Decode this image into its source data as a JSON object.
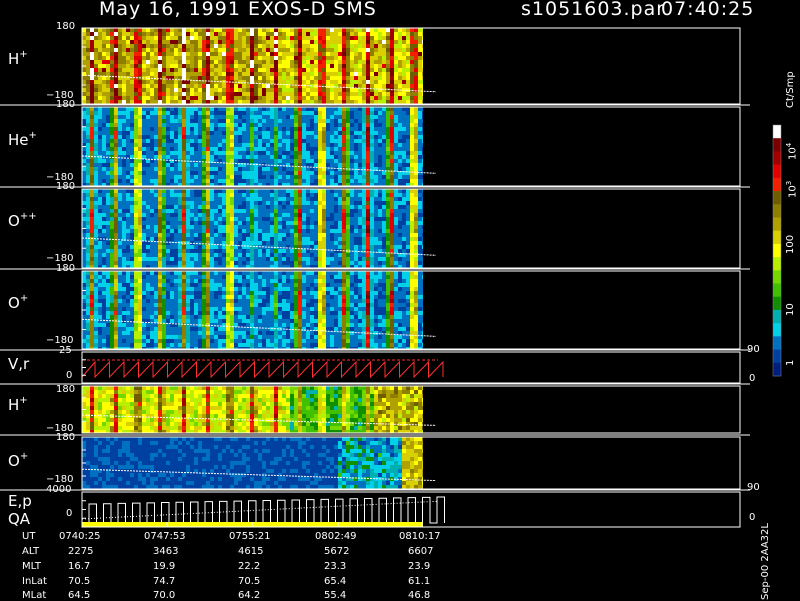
{
  "header": {
    "title": "May 16, 1991    EXOS-D SMS",
    "file": "s1051603.par",
    "time": "07:40:25"
  },
  "colorbar": {
    "label": "Ct/Smp",
    "ticks": [
      "10",
      "10",
      "10",
      "100",
      "10",
      "1"
    ],
    "exponents": [
      "4",
      "3",
      "",
      "",
      "",
      ""
    ],
    "colors": [
      "#ffffff",
      "#7a0000",
      "#a00000",
      "#e00000",
      "#f02000",
      "#6e5e00",
      "#8f7f00",
      "#b0a000",
      "#d8d000",
      "#ffff00",
      "#b8f000",
      "#74d800",
      "#40c000",
      "#109000",
      "#00b0b0",
      "#00d0e8",
      "#0070c0",
      "#0040a0",
      "#001e7c"
    ]
  },
  "panels": [
    {
      "id": "h-plus",
      "label": "H",
      "sup": "+",
      "ymax": "180",
      "ymin": "−180"
    },
    {
      "id": "he-plus",
      "label": "He",
      "sup": "+",
      "ymax": "180",
      "ymin": "−180"
    },
    {
      "id": "o-plusplus",
      "label": "O",
      "sup": "++",
      "ymax": "180",
      "ymin": "−180"
    },
    {
      "id": "o-plus",
      "label": "O",
      "sup": "+",
      "ymax": "180",
      "ymin": "−180"
    },
    {
      "id": "vr",
      "label": "V,r",
      "sup": "",
      "ymax": "25",
      "ymin": "0",
      "rmax": "90",
      "rmin": "0"
    },
    {
      "id": "h-plus-2",
      "label": "H",
      "sup": "+",
      "ymax": "180",
      "ymin": "−180"
    },
    {
      "id": "o-plus-2",
      "label": "O",
      "sup": "+",
      "ymax": "180",
      "ymin": "−180"
    },
    {
      "id": "ep-qa",
      "label": "E,p",
      "label2": "QA",
      "ymax": "4000",
      "ymin": "0",
      "rmax": "90",
      "rmin": "0"
    }
  ],
  "time_table": {
    "rows": [
      "UT",
      "ALT",
      "MLT",
      "InLat",
      "MLat"
    ],
    "columns": [
      [
        "0740:25",
        "2275",
        "16.7",
        "70.5",
        "64.5"
      ],
      [
        "0747:53",
        "3463",
        "19.9",
        "74.7",
        "70.0"
      ],
      [
        "0755:21",
        "4615",
        "22.2",
        "70.5",
        "64.2"
      ],
      [
        "0802:49",
        "5672",
        "23.3",
        "65.4",
        "55.4"
      ],
      [
        "0810:17",
        "6607",
        "23.9",
        "61.1",
        "46.8"
      ]
    ]
  },
  "footer": {
    "version": "Sep-00 2AA32L"
  },
  "chart_data": {
    "type": "heatmap",
    "title": "May 16, 1991    EXOS-D SMS",
    "x_ticks_ut": [
      "0740:25",
      "0747:53",
      "0755:21",
      "0802:49",
      "0810:17"
    ],
    "colorbar_label": "Ct/Smp",
    "colorbar_ticks": [
      "10^4",
      "10^3",
      "100",
      "10",
      "1"
    ],
    "panels": [
      "H+",
      "He+",
      "O++",
      "O+",
      "V,r",
      "H+",
      "O+",
      "E,p QA"
    ],
    "pitch_angle_range": [
      -180,
      180
    ],
    "vr_range": [
      0,
      25
    ],
    "ep_range": [
      0,
      4000
    ],
    "secondary_axis_range": [
      0,
      90
    ]
  }
}
